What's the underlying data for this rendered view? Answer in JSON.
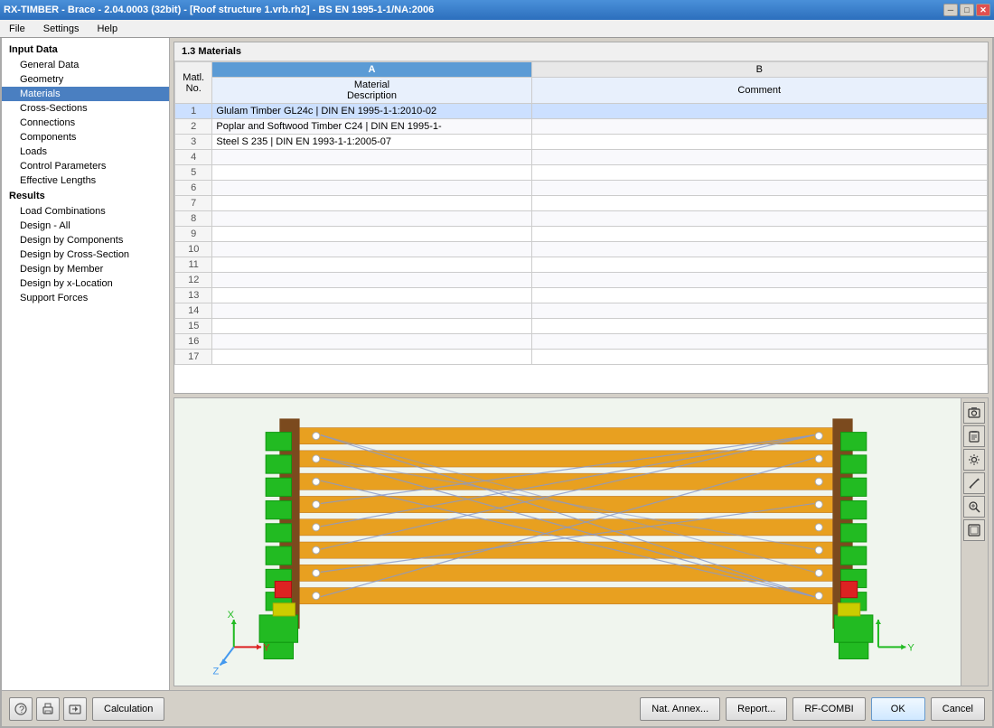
{
  "titlebar": {
    "title": "RX-TIMBER - Brace - 2.04.0003 (32bit) - [Roof structure 1.vrb.rh2] - BS EN 1995-1-1/NA:2006",
    "min": "─",
    "max": "□",
    "close": "✕"
  },
  "menubar": {
    "items": [
      "File",
      "Settings",
      "Help"
    ]
  },
  "sidebar": {
    "input_header": "Input Data",
    "items_input": [
      {
        "label": "General Data",
        "active": false,
        "indent": false
      },
      {
        "label": "Geometry",
        "active": false,
        "indent": false
      },
      {
        "label": "Materials",
        "active": true,
        "indent": false
      },
      {
        "label": "Cross-Sections",
        "active": false,
        "indent": false
      },
      {
        "label": "Connections",
        "active": false,
        "indent": false
      },
      {
        "label": "Components",
        "active": false,
        "indent": false
      },
      {
        "label": "Loads",
        "active": false,
        "indent": false
      },
      {
        "label": "Control Parameters",
        "active": false,
        "indent": false
      },
      {
        "label": "Effective Lengths",
        "active": false,
        "indent": false
      }
    ],
    "results_header": "Results",
    "items_results": [
      {
        "label": "Load Combinations",
        "active": false
      },
      {
        "label": "Design - All",
        "active": false
      },
      {
        "label": "Design by Components",
        "active": false
      },
      {
        "label": "Design by Cross-Section",
        "active": false
      },
      {
        "label": "Design by Member",
        "active": false
      },
      {
        "label": "Design by x-Location",
        "active": false
      },
      {
        "label": "Support Forces",
        "active": false
      }
    ]
  },
  "table": {
    "title": "1.3 Materials",
    "col_a": "A",
    "col_b": "B",
    "col_matno_label": "Matl.\nNo.",
    "col_material_label": "Material\nDescription",
    "col_comment_label": "Comment",
    "rows": [
      {
        "num": 1,
        "material": "Glulam Timber GL24c | DIN EN 1995-1-1:2010-02",
        "comment": "",
        "selected": true
      },
      {
        "num": 2,
        "material": "Poplar and Softwood Timber C24 | DIN EN 1995-1-",
        "comment": ""
      },
      {
        "num": 3,
        "material": "Steel S 235 | DIN EN 1993-1-1:2005-07",
        "comment": ""
      },
      {
        "num": 4,
        "material": "",
        "comment": ""
      },
      {
        "num": 5,
        "material": "",
        "comment": ""
      },
      {
        "num": 6,
        "material": "",
        "comment": ""
      },
      {
        "num": 7,
        "material": "",
        "comment": ""
      },
      {
        "num": 8,
        "material": "",
        "comment": ""
      },
      {
        "num": 9,
        "material": "",
        "comment": ""
      },
      {
        "num": 10,
        "material": "",
        "comment": ""
      },
      {
        "num": 11,
        "material": "",
        "comment": ""
      },
      {
        "num": 12,
        "material": "",
        "comment": ""
      },
      {
        "num": 13,
        "material": "",
        "comment": ""
      },
      {
        "num": 14,
        "material": "",
        "comment": ""
      },
      {
        "num": 15,
        "material": "",
        "comment": ""
      },
      {
        "num": 16,
        "material": "",
        "comment": ""
      },
      {
        "num": 17,
        "material": "",
        "comment": ""
      }
    ]
  },
  "viz_toolbar": {
    "buttons": [
      "📷",
      "📋",
      "🔧",
      "📐",
      "🔍",
      "⬜"
    ]
  },
  "bottombar": {
    "calculation_label": "Calculation",
    "nat_annex_label": "Nat. Annex...",
    "report_label": "Report...",
    "rf_combi_label": "RF-COMBI",
    "ok_label": "OK",
    "cancel_label": "Cancel"
  },
  "colors": {
    "beam_fill": "#E8A020",
    "beam_dark": "#8B4513",
    "support_green": "#22BB22",
    "support_yellow": "#DDDD00",
    "support_red": "#DD2222",
    "wire_blue": "#8899CC",
    "accent_blue": "#4a90d9"
  }
}
